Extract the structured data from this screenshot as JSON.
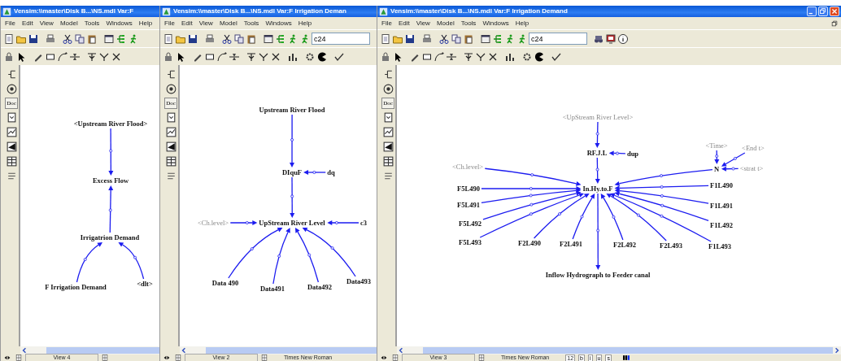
{
  "windows": [
    {
      "title": "Vensim:\\\\master\\Disk B...\\NS.mdl Var:F",
      "menu": [
        "File",
        "Edit",
        "View",
        "Model",
        "Tools",
        "Windows",
        "Help"
      ],
      "doc_button": "Doc",
      "diagram": {
        "nodes": [
          {
            "label": "<Upstream River Flood>",
            "greyed": false
          },
          {
            "label": "Excess Flow",
            "greyed": false
          },
          {
            "label": "Irrigatrion Demand",
            "greyed": false
          },
          {
            "label": "F Irrigation Demand",
            "greyed": false
          },
          {
            "label": "<dlt>",
            "greyed": false
          }
        ]
      },
      "status": {
        "view": "View 4"
      }
    },
    {
      "title": "Vensim:\\\\master\\Disk B...\\NS.mdl Var:F Irrigation Deman",
      "menu": [
        "File",
        "Edit",
        "View",
        "Model",
        "Tools",
        "Windows",
        "Help"
      ],
      "toolbar_field": "c24",
      "doc_button": "Doc",
      "diagram": {
        "nodes": [
          {
            "label": "Upstream River Flood",
            "greyed": false
          },
          {
            "label": "DIquF",
            "greyed": false
          },
          {
            "label": "dq",
            "greyed": false
          },
          {
            "label": "<Ch.level>",
            "greyed": true
          },
          {
            "label": "UpStream River Level",
            "greyed": false
          },
          {
            "label": "c3",
            "greyed": false
          },
          {
            "label": "Data 490",
            "greyed": false
          },
          {
            "label": "Data491",
            "greyed": false
          },
          {
            "label": "Data492",
            "greyed": false
          },
          {
            "label": "Data493",
            "greyed": false
          }
        ]
      },
      "status": {
        "view": "View 2",
        "font": "Times New Roman"
      }
    },
    {
      "title": "Vensim:\\\\master\\Disk B...\\NS.mdl Var:F Irrigation Demand",
      "window_controls": true,
      "menu": [
        "File",
        "Edit",
        "View",
        "Model",
        "Tools",
        "Windows",
        "Help"
      ],
      "toolbar_field": "c24",
      "doc_button": "Doc",
      "diagram": {
        "nodes": [
          {
            "label": "<UpStream River Level>",
            "greyed": true
          },
          {
            "label": "<Time>",
            "greyed": true
          },
          {
            "label": "<End t>",
            "greyed": true
          },
          {
            "label": "RF.J.L",
            "greyed": false
          },
          {
            "label": "dup",
            "greyed": false
          },
          {
            "label": "<Ch.level>",
            "greyed": true
          },
          {
            "label": "N",
            "greyed": false
          },
          {
            "label": "<strat t>",
            "greyed": true
          },
          {
            "label": "F5L490",
            "greyed": false
          },
          {
            "label": "In.Hy.to.F",
            "greyed": false
          },
          {
            "label": "F1L490",
            "greyed": false
          },
          {
            "label": "F5L491",
            "greyed": false
          },
          {
            "label": "F1L491",
            "greyed": false
          },
          {
            "label": "F5L492",
            "greyed": false
          },
          {
            "label": "F1L492",
            "greyed": false
          },
          {
            "label": "F5L493",
            "greyed": false
          },
          {
            "label": "F2L490",
            "greyed": false
          },
          {
            "label": "F2L491",
            "greyed": false
          },
          {
            "label": "F2L492",
            "greyed": false
          },
          {
            "label": "F2L493",
            "greyed": false
          },
          {
            "label": "F1L493",
            "greyed": false
          },
          {
            "label": "Inflow Hydrograph to Feeder canal",
            "greyed": false
          }
        ]
      },
      "status": {
        "view": "View 3",
        "font": "Times New Roman",
        "size": "12",
        "format_buttons": [
          "b",
          "i",
          "u",
          "s"
        ]
      }
    }
  ]
}
